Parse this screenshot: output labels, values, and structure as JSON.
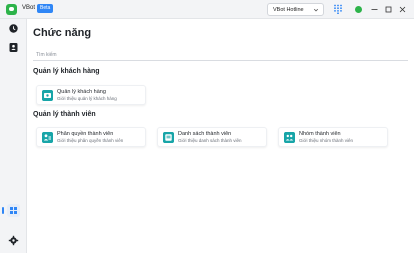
{
  "app": {
    "name": "VBot",
    "badge": "Beta",
    "hotline": "VBot Hotline"
  },
  "colors": {
    "accent": "#2f86f6",
    "card_icon": "#18a5a8",
    "status_online": "#2db34a"
  },
  "sidebar": {
    "items": [
      {
        "icon": "clock-icon"
      },
      {
        "icon": "contacts-icon"
      },
      {
        "icon": "grid-icon",
        "active": true
      },
      {
        "icon": "gear-icon"
      }
    ]
  },
  "page": {
    "title": "Chức năng",
    "search_placeholder": "Tìm kiếm"
  },
  "sections": [
    {
      "title": "Quản lý khách hàng",
      "cards": [
        {
          "title": "Quản lý khách hàng",
          "desc": "Giới thiệu quản lý khách hàng",
          "icon": "customer-card-icon"
        }
      ]
    },
    {
      "title": "Quản lý thành viên",
      "cards": [
        {
          "title": "Phân quyền thành viên",
          "desc": "Giới thiệu phân quyền thành viên",
          "icon": "permission-icon"
        },
        {
          "title": "Danh sách thành viên",
          "desc": "Giới thiệu danh sách thành viên",
          "icon": "member-list-icon"
        },
        {
          "title": "Nhóm thành viên",
          "desc": "Giới thiệu nhóm thành viên",
          "icon": "member-group-icon"
        }
      ]
    }
  ]
}
